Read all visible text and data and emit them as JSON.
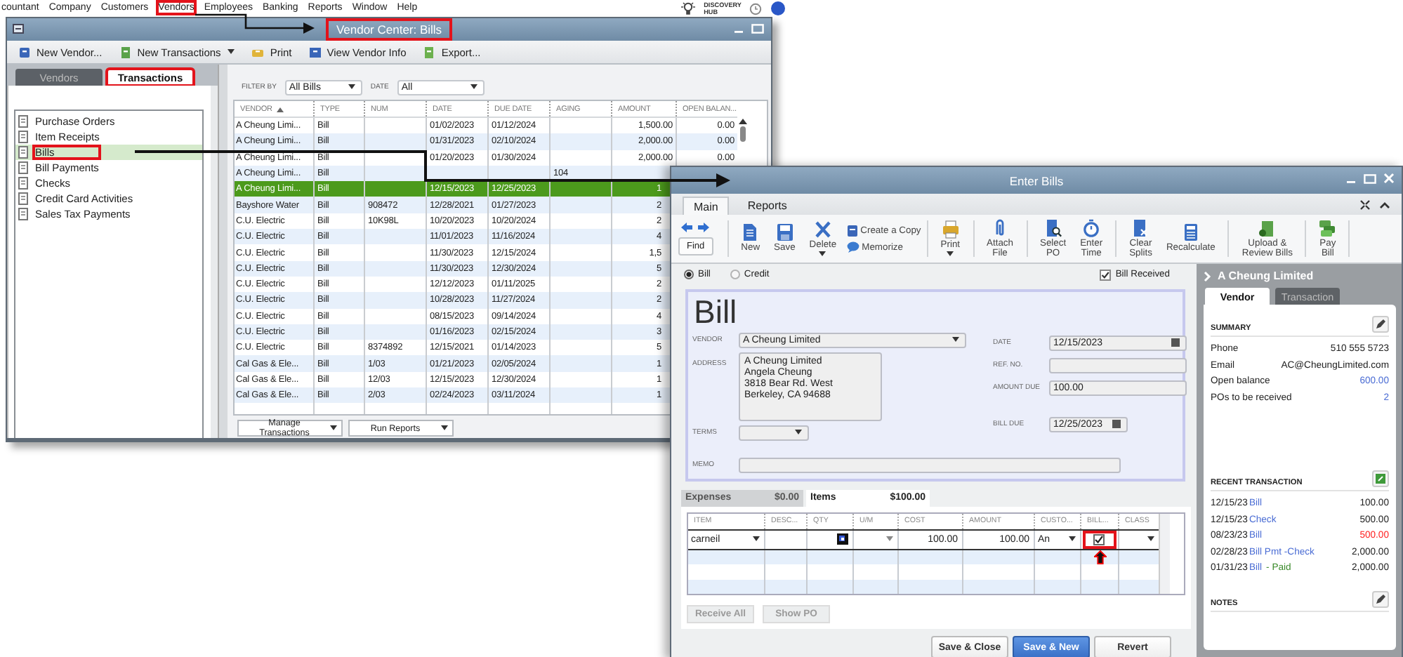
{
  "menu_bar": {
    "items": [
      {
        "label": "countant",
        "highlighted": false
      },
      {
        "label": "Company",
        "highlighted": false
      },
      {
        "label": "Customers",
        "highlighted": false
      },
      {
        "label": "Vendors",
        "highlighted": true
      },
      {
        "label": "Employees",
        "highlighted": false
      },
      {
        "label": "Banking",
        "highlighted": false
      },
      {
        "label": "Reports",
        "highlighted": false
      },
      {
        "label": "Window",
        "highlighted": false
      },
      {
        "label": "Help",
        "highlighted": false
      }
    ],
    "hub_lines": [
      "DISCOVERY",
      "HUB"
    ]
  },
  "vendor_center": {
    "title": "Vendor Center: Bills",
    "title_highlighted": true,
    "toolbar": [
      {
        "label": "New Vendor...",
        "dropdown": false
      },
      {
        "label": "New Transactions",
        "dropdown": true
      },
      {
        "label": "Print",
        "dropdown": false
      },
      {
        "label": "View Vendor Info",
        "dropdown": false
      },
      {
        "label": "Export...",
        "dropdown": false
      }
    ],
    "tabs": [
      {
        "label": "Vendors",
        "selected": false,
        "highlighted": false
      },
      {
        "label": "Transactions",
        "selected": true,
        "highlighted": true
      }
    ],
    "nav": [
      {
        "label": "Purchase Orders",
        "selected": false,
        "highlighted": false
      },
      {
        "label": "Item Receipts",
        "selected": false,
        "highlighted": false
      },
      {
        "label": "Bills",
        "selected": true,
        "highlighted": true
      },
      {
        "label": "Bill Payments",
        "selected": false,
        "highlighted": false
      },
      {
        "label": "Checks",
        "selected": false,
        "highlighted": false
      },
      {
        "label": "Credit Card Activities",
        "selected": false,
        "highlighted": false
      },
      {
        "label": "Sales Tax Payments",
        "selected": false,
        "highlighted": false
      }
    ],
    "filter": {
      "filter_by_label": "FILTER BY",
      "filter_by": "All Bills",
      "date_label": "DATE",
      "date": "All"
    },
    "table": {
      "columns": [
        {
          "label": "VENDOR",
          "sorted": true
        },
        {
          "label": "TYPE",
          "sorted": false
        },
        {
          "label": "NUM",
          "sorted": false
        },
        {
          "label": "DATE",
          "sorted": false
        },
        {
          "label": "DUE DATE",
          "sorted": false
        },
        {
          "label": "AGING",
          "sorted": false
        },
        {
          "label": "AMOUNT",
          "sorted": false
        },
        {
          "label": "OPEN BALAN...",
          "sorted": false
        }
      ],
      "rows": [
        {
          "vendor": "A Cheung Limi...",
          "type": "Bill",
          "date": "01/02/2023",
          "due_date": "01/12/2024",
          "amount": "1,500.00",
          "open_balance": "0.00",
          "selected": false
        },
        {
          "vendor": "A Cheung Limi...",
          "type": "Bill",
          "date": "01/31/2023",
          "due_date": "02/10/2024",
          "amount": "2,000.00",
          "open_balance": "0.00",
          "selected": false
        },
        {
          "vendor": "A Cheung Limi...",
          "type": "Bill",
          "date": "01/20/2023",
          "due_date": "01/30/2024",
          "amount": "2,000.00",
          "open_balance": "0.00",
          "selected": false
        },
        {
          "vendor": "A Cheung Limi...",
          "type": "Bill",
          "aging": "104",
          "selected": false
        },
        {
          "vendor": "A Cheung Limi...",
          "type": "Bill",
          "date": "12/15/2023",
          "due_date": "12/25/2023",
          "amount": "1",
          "selected": true
        },
        {
          "vendor": "Bayshore Water",
          "type": "Bill",
          "num": "908472",
          "date": "12/28/2021",
          "due_date": "01/27/2023",
          "amount": "2",
          "selected": false
        },
        {
          "vendor": "C.U. Electric",
          "type": "Bill",
          "num": "10K98L",
          "date": "10/20/2023",
          "due_date": "10/20/2024",
          "amount": "2",
          "selected": false
        },
        {
          "vendor": "C.U. Electric",
          "type": "Bill",
          "date": "11/01/2023",
          "due_date": "11/16/2024",
          "amount": "4",
          "selected": false
        },
        {
          "vendor": "C.U. Electric",
          "type": "Bill",
          "date": "11/30/2023",
          "due_date": "12/15/2024",
          "amount": "1,5",
          "selected": false
        },
        {
          "vendor": "C.U. Electric",
          "type": "Bill",
          "date": "11/30/2023",
          "due_date": "12/30/2024",
          "amount": "5",
          "selected": false
        },
        {
          "vendor": "C.U. Electric",
          "type": "Bill",
          "date": "12/12/2023",
          "due_date": "01/11/2025",
          "amount": "2",
          "selected": false
        },
        {
          "vendor": "C.U. Electric",
          "type": "Bill",
          "date": "10/28/2023",
          "due_date": "11/27/2024",
          "amount": "2",
          "selected": false
        },
        {
          "vendor": "C.U. Electric",
          "type": "Bill",
          "date": "08/15/2023",
          "due_date": "09/14/2024",
          "amount": "4",
          "selected": false
        },
        {
          "vendor": "C.U. Electric",
          "type": "Bill",
          "date": "01/16/2023",
          "due_date": "02/15/2024",
          "amount": "3",
          "selected": false
        },
        {
          "vendor": "C.U. Electric",
          "type": "Bill",
          "num": "8374892",
          "date": "12/15/2021",
          "due_date": "01/14/2023",
          "amount": "5",
          "selected": false
        },
        {
          "vendor": "Cal Gas & Ele...",
          "type": "Bill",
          "num": "1/03",
          "date": "01/21/2023",
          "due_date": "02/05/2024",
          "amount": "1",
          "selected": false
        },
        {
          "vendor": "Cal Gas & Ele...",
          "type": "Bill",
          "num": "12/03",
          "date": "12/15/2023",
          "due_date": "12/30/2024",
          "amount": "1",
          "selected": false
        },
        {
          "vendor": "Cal Gas & Ele...",
          "type": "Bill",
          "num": "2/03",
          "date": "02/24/2023",
          "due_date": "03/11/2024",
          "amount": "1",
          "selected": false
        }
      ]
    },
    "buttons": [
      "Manage Transactions",
      "Run Reports"
    ]
  },
  "enter_bills": {
    "title": "Enter Bills",
    "ribbon_tabs": [
      {
        "label": "Main",
        "selected": true
      },
      {
        "label": "Reports",
        "selected": false
      }
    ],
    "toolbar": [
      {
        "kind": "find",
        "label": "Find"
      },
      {
        "kind": "separator"
      },
      {
        "kind": "large",
        "label": "New",
        "dropdown": false
      },
      {
        "kind": "large",
        "label": "Save",
        "dropdown": false
      },
      {
        "kind": "large",
        "label": "Delete",
        "dropdown": true
      },
      {
        "kind": "stack",
        "items": [
          "Create a Copy",
          "Memorize"
        ]
      },
      {
        "kind": "separator"
      },
      {
        "kind": "large",
        "label": "Print",
        "dropdown": true
      },
      {
        "kind": "separator"
      },
      {
        "kind": "large",
        "label": "Attach\nFile",
        "dropdown": false
      },
      {
        "kind": "separator"
      },
      {
        "kind": "large",
        "label": "Select\nPO",
        "dropdown": false
      },
      {
        "kind": "large",
        "label": "Enter\nTime",
        "dropdown": false
      },
      {
        "kind": "separator"
      },
      {
        "kind": "large",
        "label": "Clear\nSplits",
        "dropdown": false
      },
      {
        "kind": "large",
        "label": "Recalculate",
        "dropdown": false
      },
      {
        "kind": "separator"
      },
      {
        "kind": "large",
        "label": "Upload &\nReview Bills",
        "dropdown": false
      },
      {
        "kind": "separator"
      },
      {
        "kind": "large",
        "label": "Pay\nBill",
        "dropdown": false
      },
      {
        "kind": "separator"
      }
    ],
    "type_options": [
      {
        "label": "Bill",
        "selected": true
      },
      {
        "label": "Credit",
        "selected": false
      }
    ],
    "bill_received": {
      "label": "Bill Received",
      "checked": true
    },
    "form": {
      "heading": "Bill",
      "vendor_label": "VENDOR",
      "vendor": "A Cheung Limited",
      "address_label": "ADDRESS",
      "address": [
        "A Cheung Limited",
        "Angela Cheung",
        "3818 Bear Rd. West",
        "Berkeley, CA 94688"
      ],
      "terms_label": "TERMS",
      "memo_label": "MEMO",
      "date_label": "DATE",
      "date": "12/15/2023",
      "ref_label": "REF. NO.",
      "amount_due_label": "AMOUNT DUE",
      "amount_due": "100.00",
      "bill_due_label": "BILL DUE",
      "bill_due": "12/25/2023"
    },
    "detail_tabs": [
      {
        "label": "Expenses",
        "amount": "$0.00",
        "selected": false
      },
      {
        "label": "Items",
        "amount": "$100.00",
        "selected": true
      }
    ],
    "items_table": {
      "columns": [
        "ITEM",
        "DESC...",
        "QTY",
        "U/M",
        "COST",
        "AMOUNT",
        "CUSTO...",
        "BILL...",
        "CLASS"
      ],
      "rows": [
        {
          "item": "carneil",
          "cost": "100.00",
          "amount": "100.00",
          "customer": "An",
          "billable": true,
          "billable_highlighted": true
        }
      ]
    },
    "action_buttons": [
      {
        "label": "Receive All",
        "disabled": true
      },
      {
        "label": "Show PO",
        "disabled": true
      }
    ],
    "footer_buttons": [
      {
        "label": "Save & Close",
        "primary": false
      },
      {
        "label": "Save & New",
        "primary": true
      },
      {
        "label": "Revert",
        "primary": false
      }
    ],
    "side_panel": {
      "vendor_name": "A Cheung Limited",
      "tabs": [
        {
          "label": "Vendor",
          "selected": true
        },
        {
          "label": "Transaction",
          "selected": false
        }
      ],
      "summary_title": "SUMMARY",
      "summary": [
        {
          "label": "Phone",
          "value": "510 555 5723",
          "kind": "plain"
        },
        {
          "label": "Email",
          "value": "AC@CheungLimited.com",
          "kind": "plain"
        },
        {
          "label": "Open balance",
          "value": "600.00",
          "kind": "link"
        },
        {
          "label": "POs to be received",
          "value": "2",
          "kind": "link"
        }
      ],
      "recent_title": "RECENT TRANSACTION",
      "recent": [
        {
          "date": "12/15/23",
          "type": "Bill",
          "amount": "100.00",
          "overdue": false
        },
        {
          "date": "12/15/23",
          "type": "Check",
          "amount": "500.00",
          "overdue": false
        },
        {
          "date": "08/23/23",
          "type": "Bill",
          "amount": "500.00",
          "overdue": true
        },
        {
          "date": "02/28/23",
          "type": "Bill Pmt -Check",
          "amount": "2,000.00",
          "overdue": false
        },
        {
          "date": "01/31/23",
          "type": "Bill",
          "status": "- Paid",
          "amount": "2,000.00",
          "overdue": false
        }
      ],
      "notes_title": "NOTES"
    }
  }
}
